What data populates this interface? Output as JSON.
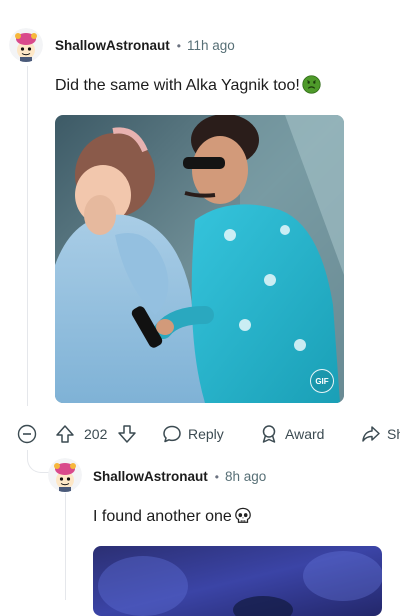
{
  "comment1": {
    "username": "ShallowAstronaut",
    "separator": "•",
    "time": "11h ago",
    "text": "Did the same with Alka Yagnik too!",
    "emoji_icon": "nauseated-face-icon",
    "media_badge": "GIF",
    "actions": {
      "upvote_count": "202",
      "reply_label": "Reply",
      "award_label": "Award",
      "share_label": "Sh"
    }
  },
  "comment2": {
    "username": "ShallowAstronaut",
    "separator": "•",
    "time": "8h ago",
    "text": "I found another one",
    "emoji_icon": "skull-icon"
  },
  "colors": {
    "accent_shirt": "#1fb5cc",
    "muted_text": "#576f76",
    "thread_line": "#e5e7eb"
  }
}
